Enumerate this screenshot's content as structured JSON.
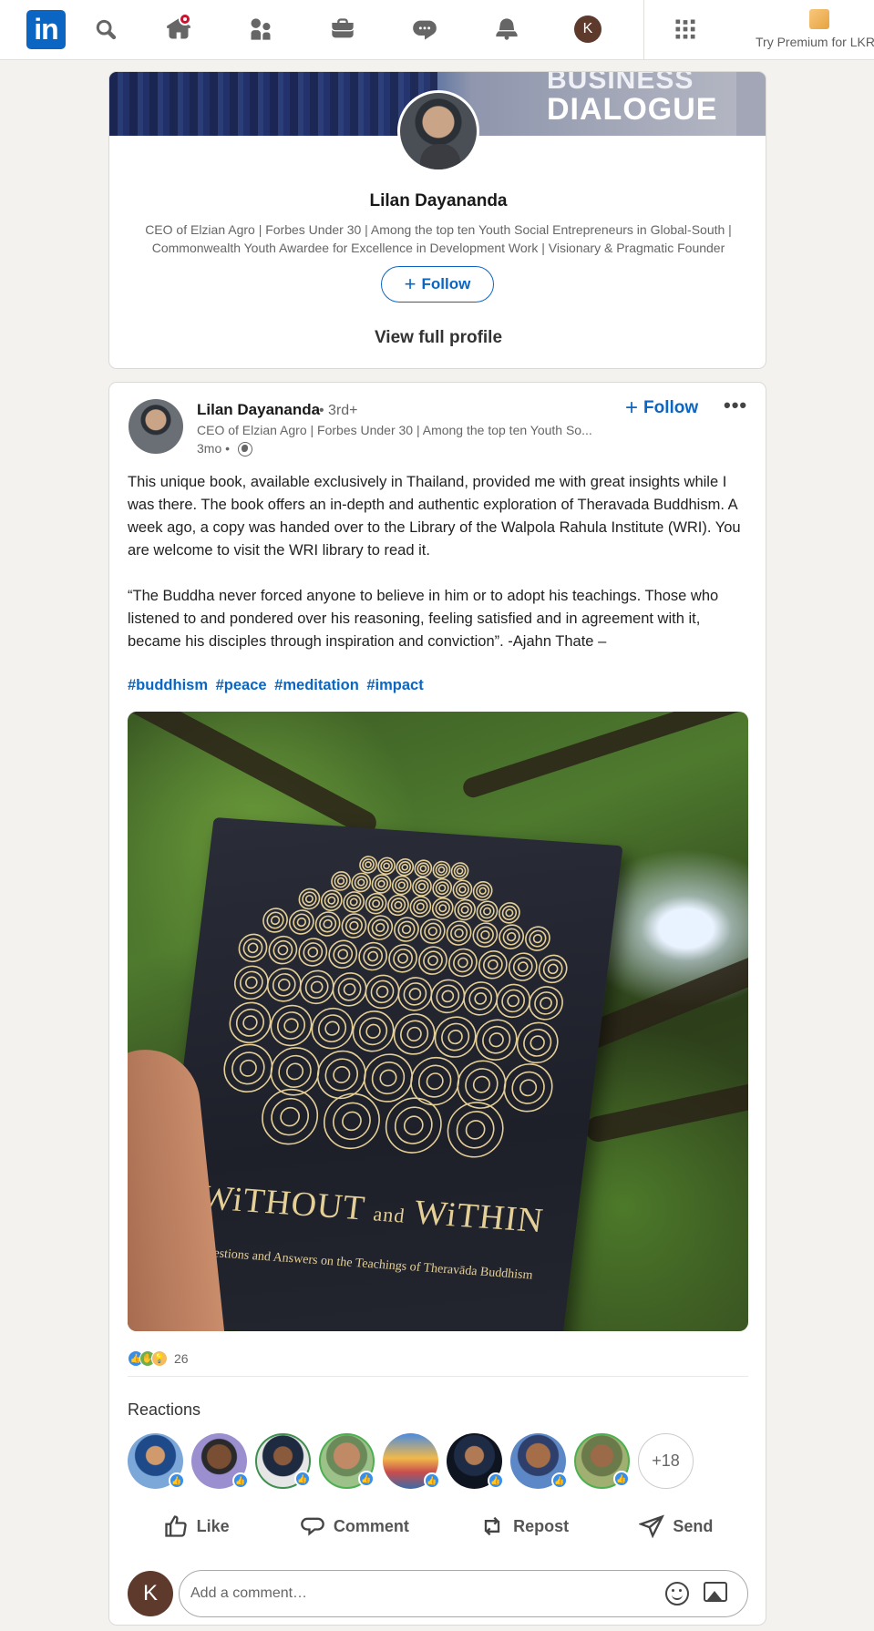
{
  "nav": {
    "logo_text": "in",
    "icons": [
      "search-icon",
      "home-icon",
      "my-network-icon",
      "jobs-icon",
      "messaging-icon",
      "notifications-icon",
      "me-avatar",
      "work-grid-icon"
    ],
    "me_initial": "K",
    "premium_label": "Try Premium for LKR",
    "colors": {
      "brand": "#0a66c2",
      "notification_badge": "#cb112d"
    }
  },
  "profile_card": {
    "banner_text_line1": "BUSINESS",
    "banner_text_line2": "DIALOGUE",
    "name": "Lilan Dayananda",
    "headline": "CEO of Elzian Agro | Forbes Under 30 | Among the top ten Youth Social Entrepreneurs in Global-South | Commonwealth Youth Awardee for Excellence in Development Work | Visionary & Pragmatic Founder",
    "follow_label": "Follow",
    "view_profile_label": "View full profile"
  },
  "post": {
    "author_name": "Lilan Dayananda",
    "degree": "• 3rd+",
    "author_headline": "CEO of Elzian Agro | Forbes Under 30 | Among the top ten Youth So...",
    "time": "3mo •",
    "follow_label": "Follow",
    "more_label": "•••",
    "paragraph1": "This unique book, available exclusively in Thailand, provided me with great insights while I was there. The book offers an in-depth and authentic exploration of Theravada Buddhism. A week ago, a copy was handed over to the Library of the Walpola Rahula Institute (WRI). You are welcome to visit the WRI library to read it.",
    "paragraph2": "“The Buddha never forced anyone to believe in him or to adopt his teachings. Those who listened to and pondered over his reasoning, feeling satisfied and in agreement with it, became his disciples through inspiration and conviction”. -Ajahn Thate –",
    "hashtags": [
      "#buddhism",
      "#peace",
      "#meditation",
      "#impact"
    ],
    "image": {
      "book_title_part1": "WiTHOUT",
      "book_title_and": "and",
      "book_title_part2": "WiTHIN",
      "book_subtitle": "Questions and Answers on the Teachings of Theravāda Buddhism"
    },
    "reaction_count": "26",
    "reactions_title": "Reactions",
    "more_reactors": "+18",
    "actions": {
      "like": "Like",
      "comment": "Comment",
      "repost": "Repost",
      "send": "Send"
    },
    "comment_avatar_initial": "K",
    "comment_placeholder": "Add a comment…"
  }
}
